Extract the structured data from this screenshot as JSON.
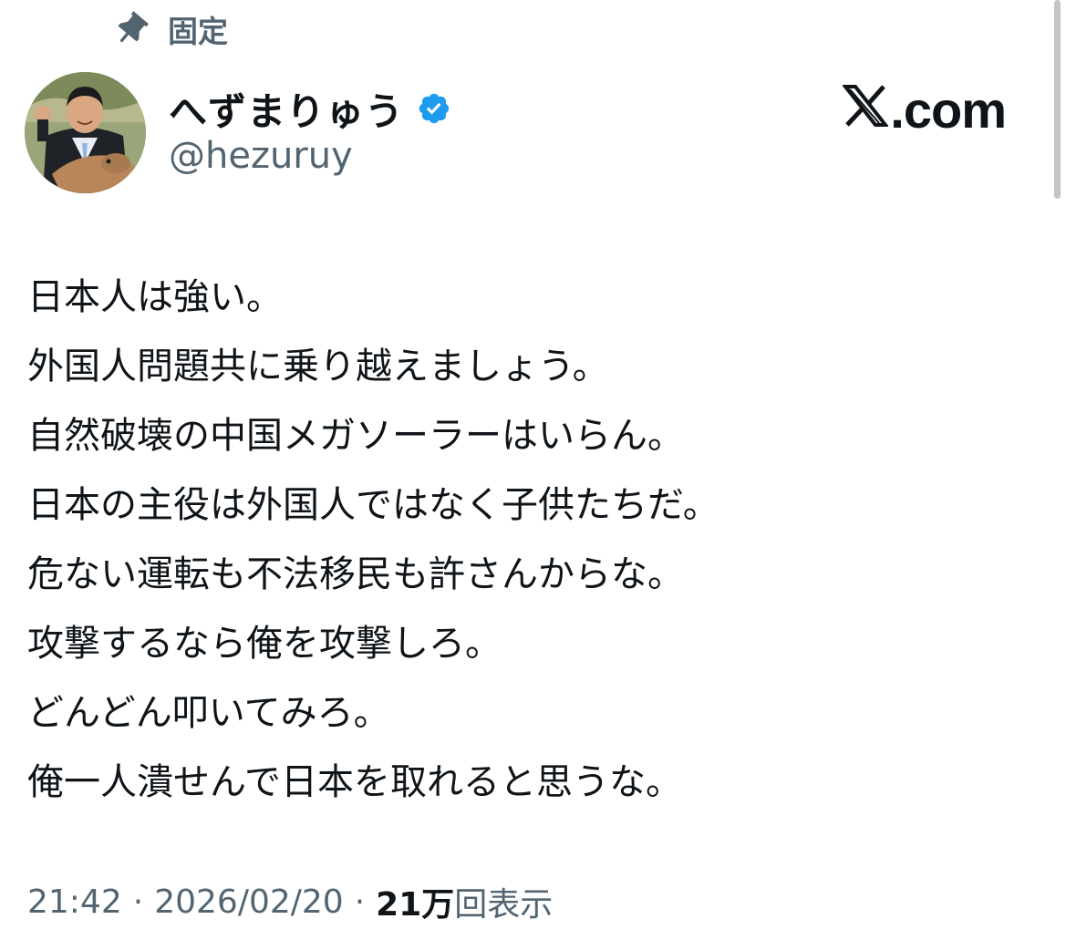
{
  "pinned": {
    "icon": "pin-icon",
    "label": "固定"
  },
  "author": {
    "avatar_icon": "avatar",
    "display_name": "へずまりゅう",
    "verified_icon": "verified-badge-icon",
    "verified_color": "#1d9bf0",
    "handle": "@hezuruy"
  },
  "brand": {
    "logo_icon": "x-logo-icon",
    "text": ".com"
  },
  "tweet": {
    "lines": [
      "日本人は強い。",
      "外国人問題共に乗り越えましょう。",
      "自然破壊の中国メガソーラーはいらん。",
      "日本の主役は外国人ではなく子供たちだ。",
      "危ない運転も不法移民も許さんからな。",
      "攻撃するなら俺を攻撃しろ。",
      "どんどん叩いてみろ。",
      "俺一人潰せんで日本を取れると思うな。"
    ]
  },
  "meta": {
    "time": "21:42",
    "separator": "·",
    "date": "2026/02/20",
    "views_count": "21万",
    "views_label": "回表示"
  },
  "colors": {
    "text_primary": "#0f1419",
    "text_secondary": "#536471",
    "accent": "#1d9bf0"
  }
}
